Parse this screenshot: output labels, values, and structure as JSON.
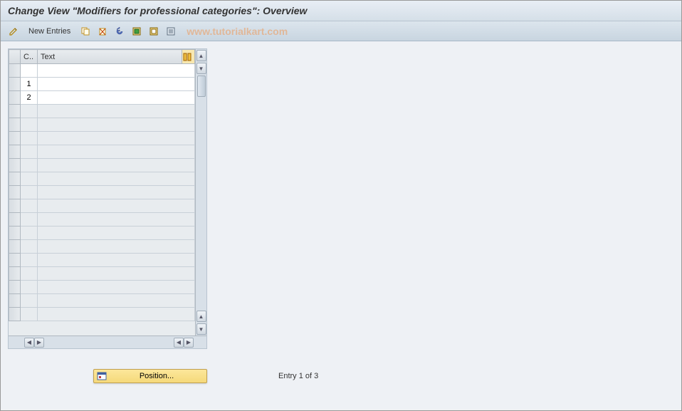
{
  "title": "Change View \"Modifiers for professional categories\": Overview",
  "toolbar": {
    "new_entries": "New Entries"
  },
  "watermark": "www.tutorialkart.com",
  "table": {
    "columns": {
      "c": "C..",
      "text": "Text"
    },
    "rows": [
      {
        "c": "",
        "text": ""
      },
      {
        "c": "1",
        "text": ""
      },
      {
        "c": "2",
        "text": ""
      }
    ]
  },
  "footer": {
    "position_btn": "Position...",
    "entry_status": "Entry 1 of 3"
  }
}
